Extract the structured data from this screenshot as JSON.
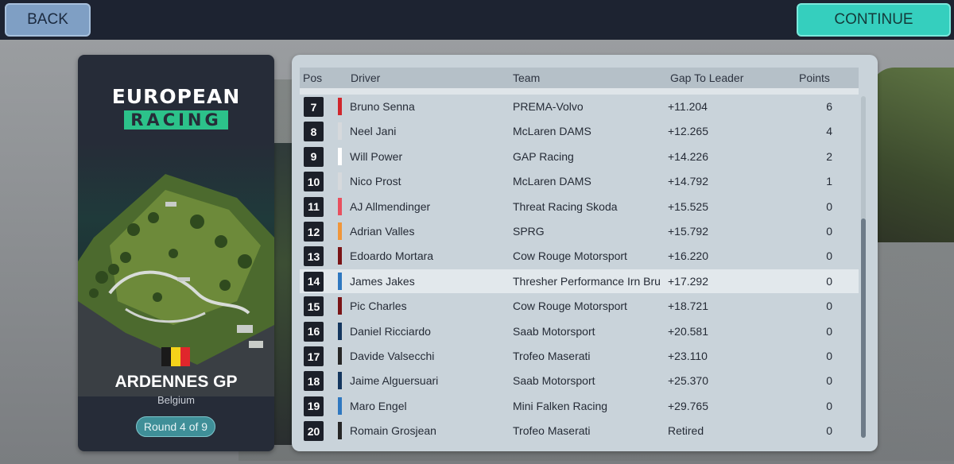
{
  "topbar": {
    "back_label": "BACK",
    "continue_label": "CONTINUE"
  },
  "event": {
    "series_line1": "EUROPEAN",
    "series_line2": "RACING",
    "track_name": "ARDENNES GP",
    "country": "Belgium",
    "round_label": "Round 4 of 9",
    "flag_colors": [
      "#1a1a1a",
      "#f5d21a",
      "#e0262c"
    ]
  },
  "results": {
    "headers": {
      "pos": "Pos",
      "driver": "Driver",
      "team": "Team",
      "gap": "Gap To Leader",
      "points": "Points"
    },
    "rows": [
      {
        "pos": "7",
        "driver": "Bruno Senna",
        "team": "PREMA-Volvo",
        "gap": "+11.204",
        "points": "6",
        "color": "#d0262c"
      },
      {
        "pos": "8",
        "driver": "Neel Jani",
        "team": "McLaren DAMS",
        "gap": "+12.265",
        "points": "4",
        "color": "#d6d9dc"
      },
      {
        "pos": "9",
        "driver": "Will Power",
        "team": "GAP Racing",
        "gap": "+14.226",
        "points": "2",
        "color": "#ffffff"
      },
      {
        "pos": "10",
        "driver": "Nico Prost",
        "team": "McLaren DAMS",
        "gap": "+14.792",
        "points": "1",
        "color": "#d6d9dc"
      },
      {
        "pos": "11",
        "driver": "AJ Allmendinger",
        "team": "Threat Racing Skoda",
        "gap": "+15.525",
        "points": "0",
        "color": "#e8505e"
      },
      {
        "pos": "12",
        "driver": "Adrian Valles",
        "team": "SPRG",
        "gap": "+15.792",
        "points": "0",
        "color": "#f0963a"
      },
      {
        "pos": "13",
        "driver": "Edoardo Mortara",
        "team": "Cow Rouge Motorsport",
        "gap": "+16.220",
        "points": "0",
        "color": "#7a1416"
      },
      {
        "pos": "14",
        "driver": "James Jakes",
        "team": "Thresher Performance Irn Bru",
        "gap": "+17.292",
        "points": "0",
        "color": "#2f78c0"
      },
      {
        "pos": "15",
        "driver": "Pic Charles",
        "team": "Cow Rouge Motorsport",
        "gap": "+18.721",
        "points": "0",
        "color": "#7a1416"
      },
      {
        "pos": "16",
        "driver": "Daniel Ricciardo",
        "team": "Saab Motorsport",
        "gap": "+20.581",
        "points": "0",
        "color": "#14365e"
      },
      {
        "pos": "17",
        "driver": "Davide Valsecchi",
        "team": "Trofeo Maserati",
        "gap": "+23.110",
        "points": "0",
        "color": "#262626"
      },
      {
        "pos": "18",
        "driver": "Jaime Alguersuari",
        "team": "Saab Motorsport",
        "gap": "+25.370",
        "points": "0",
        "color": "#14365e"
      },
      {
        "pos": "19",
        "driver": "Maro Engel",
        "team": "Mini Falken Racing",
        "gap": "+29.765",
        "points": "0",
        "color": "#2f78c0"
      },
      {
        "pos": "20",
        "driver": "Romain Grosjean",
        "team": "Trofeo Maserati",
        "gap": "Retired",
        "points": "0",
        "color": "#262626"
      }
    ],
    "highlighted_row": 7
  }
}
